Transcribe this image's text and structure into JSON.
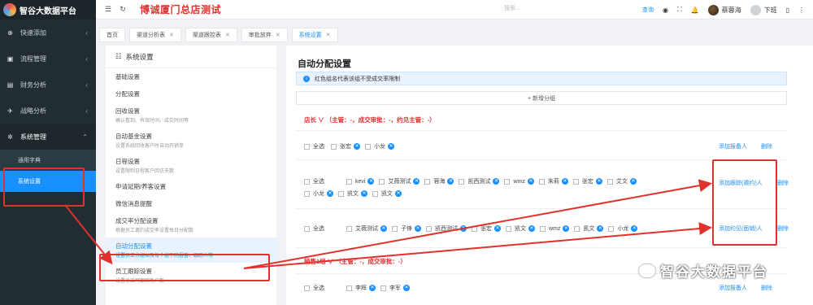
{
  "brand": {
    "name": "智谷大数据平台"
  },
  "sidebar": {
    "items": [
      {
        "icon": "plus-circle-icon",
        "glyph": "⊕",
        "label": "快速添加"
      },
      {
        "icon": "briefcase-icon",
        "glyph": "▣",
        "label": "流程管理"
      },
      {
        "icon": "chart-icon",
        "glyph": "▤",
        "label": "财务分析"
      },
      {
        "icon": "plane-icon",
        "glyph": "✈",
        "label": "战略分析"
      },
      {
        "icon": "gear-icon",
        "glyph": "✲",
        "label": "系统管理"
      }
    ],
    "sub_items": [
      {
        "label": "通用字典"
      },
      {
        "label": "系统设置"
      }
    ]
  },
  "header": {
    "title": "博诚厦门总店测试",
    "search_placeholder": "搜索...",
    "search_link": "查询",
    "user_name": "蔡蓉海",
    "logout": "下班"
  },
  "tabs": [
    {
      "label": "首页"
    },
    {
      "label": "渠道分析表"
    },
    {
      "label": "渠道跟控表"
    },
    {
      "label": "审批放弃"
    },
    {
      "label": "系统设置"
    }
  ],
  "settings_panel": {
    "title": "系统设置",
    "items": [
      {
        "label": "基础设置",
        "desc": ""
      },
      {
        "label": "分配设置",
        "desc": ""
      },
      {
        "label": "回收设置",
        "desc": "确认看到、有效时间、成交时间等"
      },
      {
        "label": "自动基金设置",
        "desc": "设置系统回收客户时自动开销单"
      },
      {
        "label": "日程设置",
        "desc": "设置限制日程客户回访天数"
      },
      {
        "label": "申请延期/养客设置",
        "desc": ""
      },
      {
        "label": "微信消息提醒",
        "desc": ""
      },
      {
        "label": "成交率分配设置",
        "desc": "根据员工邀约成交率设置每日分配数"
      },
      {
        "label": "自动分配设置",
        "desc": "设置员工分组以及每个组下的报备、跟踪人等"
      },
      {
        "label": "员工跟踪设置",
        "desc": "设置员工可跟踪客户数"
      }
    ]
  },
  "main": {
    "title": "自动分配设置",
    "notice": "红色组名代表该组不受成交率限制",
    "add_group": "+ 新增分组",
    "select_all": "全选",
    "delete": "删除",
    "groups": [
      {
        "head": "店长 ∨ （主管：-，成交审批：-，约见主管：-）",
        "rows": [
          {
            "people": [
              "张宏",
              "小龙"
            ],
            "action": "添加报备人"
          },
          {
            "people": [
              "kevi",
              "艾薇测试",
              "蓉海",
              "凯西测试",
              "wmz",
              "朱莉",
              "张宏",
              "艾文",
              "小龙",
              "凯文",
              "凯文"
            ],
            "action": "添加跟踪(邀约)人"
          },
          {
            "people": [
              "艾薇测试",
              "子锋",
              "凯西测试",
              "张宏",
              "凯文",
              "wmz",
              "凯文",
              "小龙"
            ],
            "action": "添加约见(面销)人"
          }
        ]
      },
      {
        "head": "销售1组 ∨ （主管：-，成交审批：-）",
        "rows": [
          {
            "people": [
              "李辉",
              "李军"
            ],
            "action": "添加报备人"
          }
        ]
      }
    ]
  },
  "watermark": "智谷大数据平台",
  "colors": {
    "primary": "#1890ff",
    "danger": "#e0312d",
    "sidebar": "#222d32"
  }
}
